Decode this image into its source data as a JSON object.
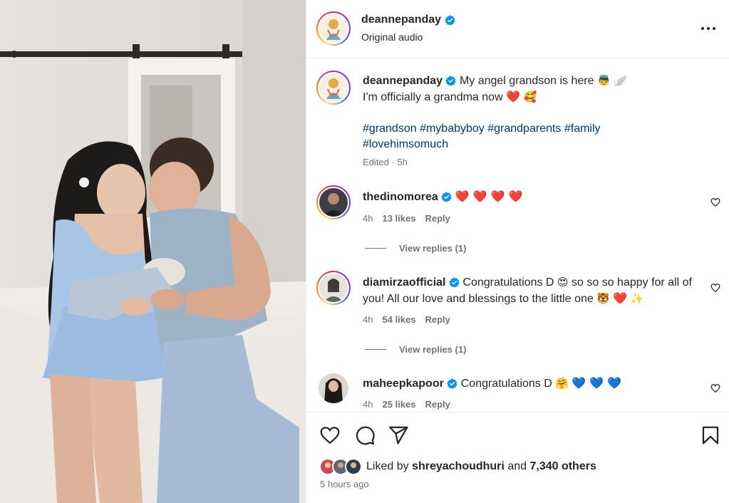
{
  "post": {
    "username": "deannepanday",
    "audio": "Original audio",
    "caption": {
      "text_line1": "My angel grandson is here",
      "emoji_angel": "👼",
      "emoji_wing": "🪽",
      "text_line2": "I'm officially a grandma now",
      "emoji_heart": "❤️",
      "emoji_smiling_hearts": "🥰",
      "hashtags_line1": "#grandson #mybabyboy #grandparents #family",
      "hashtags_line2": "#lovehimsomuch",
      "edited": "Edited · 5h"
    }
  },
  "comments": [
    {
      "username": "thedinomorea",
      "text": "",
      "emojis": "❤️ ❤️ ❤️ ❤️",
      "time": "4h",
      "likes": "13 likes",
      "reply": "Reply",
      "view_replies": "View replies (1)"
    },
    {
      "username": "diamirzaofficial",
      "text_a": "Congratulations D",
      "emoji_a": "😍",
      "text_b": "so so so happy for all of you! All our love and blessings to the little one",
      "emoji_b": "🐯",
      "emoji_c": "❤️",
      "emoji_d": "✨",
      "time": "4h",
      "likes": "54 likes",
      "reply": "Reply",
      "view_replies": "View replies (1)"
    },
    {
      "username": "maheepkapoor",
      "text": "Congratulations D",
      "emoji_hug": "🤗",
      "emoji_blue": "💙 💙 💙",
      "time": "4h",
      "likes": "25 likes",
      "reply": "Reply"
    }
  ],
  "footer": {
    "liked_by_prefix": "Liked by",
    "liked_by_user": "shreyachoudhuri",
    "and": "and",
    "others": "7,340 others",
    "time_ago": "5 hours ago"
  },
  "icons": {
    "verified": "verified-badge-icon",
    "more": "more-options-icon",
    "like": "heart-icon",
    "comment": "comment-icon",
    "share": "share-icon",
    "save": "bookmark-icon"
  },
  "colors": {
    "verified": "#0095f6",
    "hashtag": "#00376b",
    "secondary_text": "#737373"
  }
}
